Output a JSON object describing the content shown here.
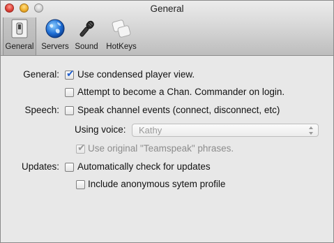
{
  "window": {
    "title": "General"
  },
  "toolbar": {
    "items": [
      {
        "label": "General",
        "icon": "general-switch-icon",
        "selected": true
      },
      {
        "label": "Servers",
        "icon": "globe-icon",
        "selected": false
      },
      {
        "label": "Sound",
        "icon": "microphone-icon",
        "selected": false
      },
      {
        "label": "HotKeys",
        "icon": "hotkeys-icon",
        "selected": false
      }
    ]
  },
  "general": {
    "section_label": "General:",
    "condensed": {
      "label": "Use condensed player view.",
      "checked": true
    },
    "commander": {
      "label": "Attempt to become a Chan. Commander on login.",
      "checked": false
    }
  },
  "speech": {
    "section_label": "Speech:",
    "speak_events": {
      "label": "Speak channel events (connect, disconnect, etc)",
      "checked": false
    },
    "voice_label": "Using voice:",
    "voice_value": "Kathy",
    "original_phrases": {
      "label": "Use original \"Teamspeak\" phrases.",
      "checked": true,
      "disabled": true
    }
  },
  "updates": {
    "section_label": "Updates:",
    "auto_check": {
      "label": "Automatically check for updates",
      "checked": false
    },
    "anon_profile": {
      "label": "Include anonymous sytem profile",
      "checked": false
    }
  },
  "colors": {
    "check_accent": "#1f5fcf",
    "selected_tab": "#b9b9b9"
  }
}
